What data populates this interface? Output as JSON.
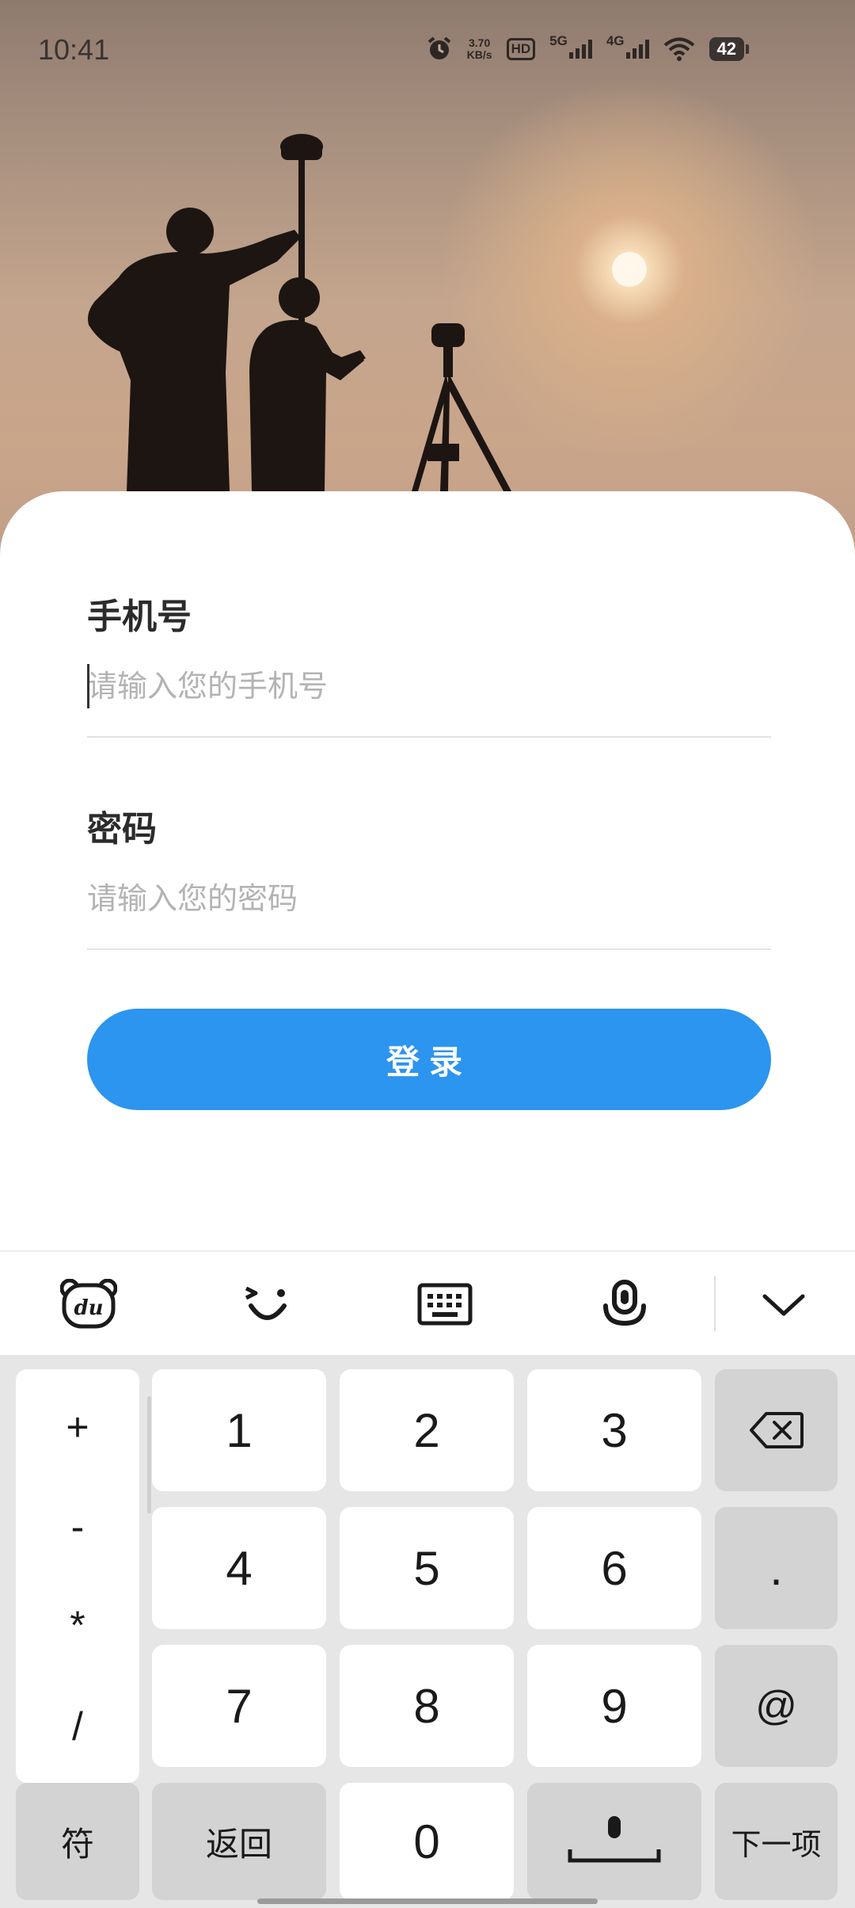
{
  "status_bar": {
    "time": "10:41",
    "net_speed_value": "3.70",
    "net_speed_unit": "KB/s",
    "hd_label": "HD",
    "sig1_label": "5G",
    "sig2_label": "4G",
    "battery": "42"
  },
  "form": {
    "phone_label": "手机号",
    "phone_placeholder": "请输入您的手机号",
    "password_label": "密码",
    "password_placeholder": "请输入您的密码",
    "login_button": "登录"
  },
  "keyboard_toolbar": {
    "icons": [
      "du-bear-logo-icon",
      "emoji-face-icon",
      "keyboard-icon",
      "microphone-icon",
      "chevron-down-icon"
    ],
    "bear_text": "du"
  },
  "keyboard": {
    "symbols": [
      "+",
      "-",
      "*",
      "/"
    ],
    "digits": [
      "1",
      "2",
      "3",
      "4",
      "5",
      "6",
      "7",
      "8",
      "9",
      "0"
    ],
    "dot": ".",
    "at": "@",
    "symbols_key": "符",
    "back_key": "返回",
    "next_key": "下一项"
  }
}
